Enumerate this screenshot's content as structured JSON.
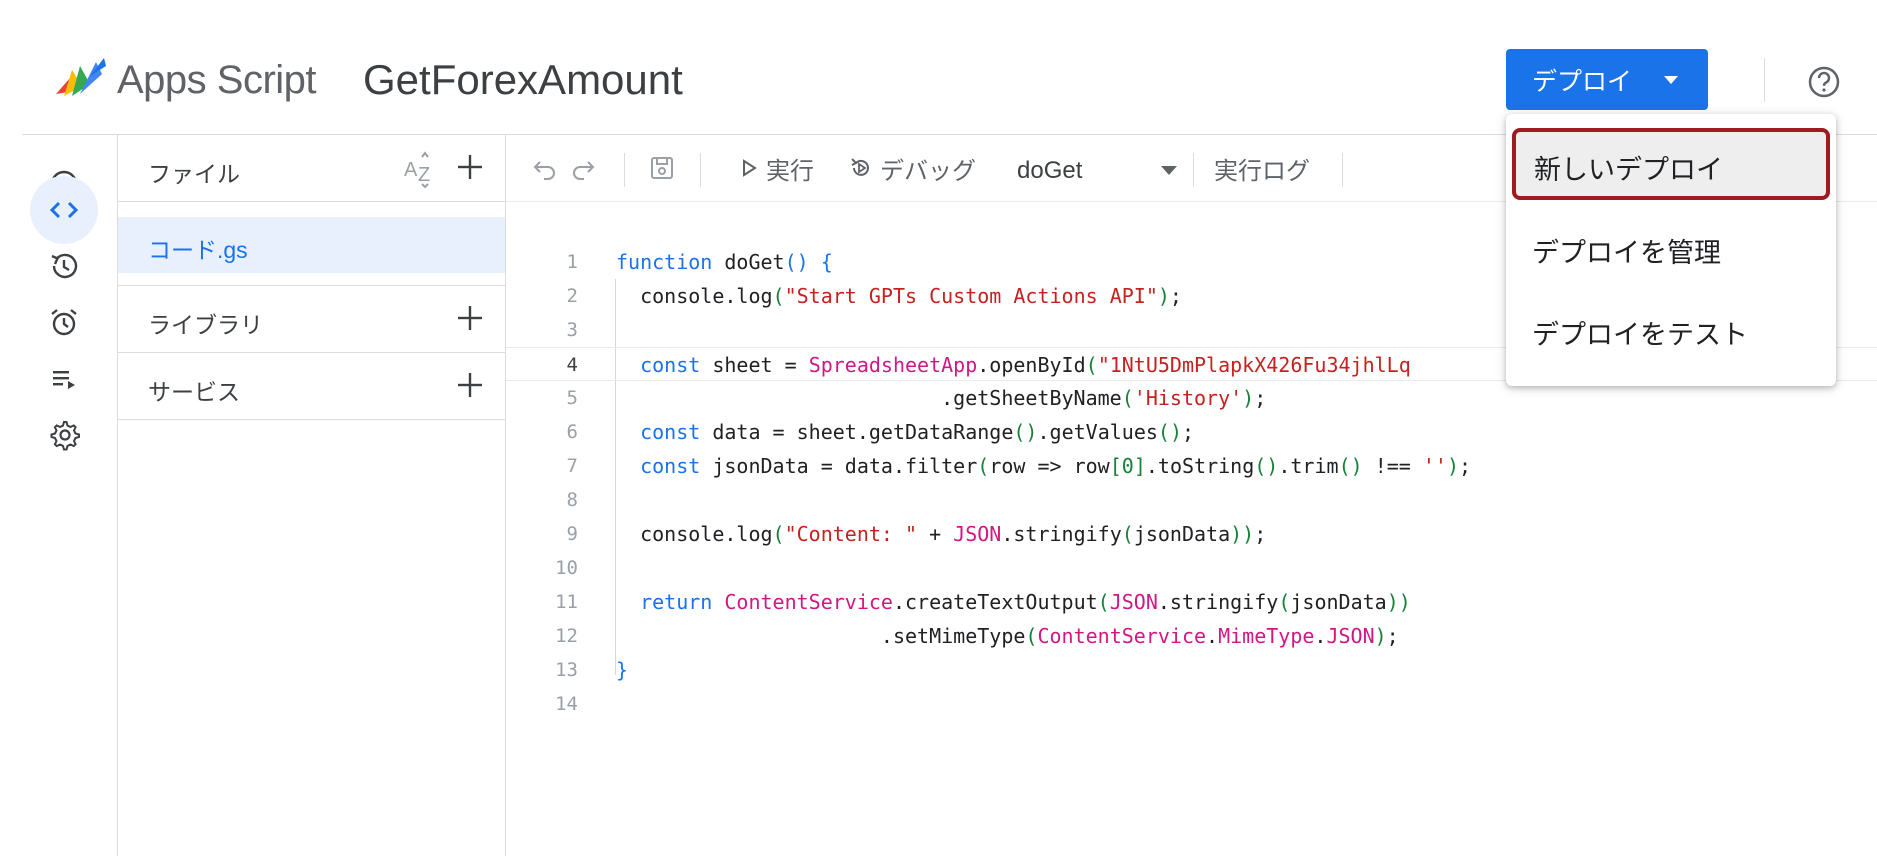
{
  "header": {
    "app_name": "Apps Script",
    "project_title": "GetForexAmount",
    "deploy_label": "デプロイ",
    "icons": [
      "apps-script-logo",
      "caret-down-icon",
      "help-icon"
    ]
  },
  "rail": {
    "items": [
      "info-icon",
      "code-icon",
      "history-icon",
      "alarm-icon",
      "executions-icon",
      "settings-icon"
    ],
    "active": "code-icon"
  },
  "files_panel": {
    "files_label": "ファイル",
    "selected_file": "コード.gs",
    "libraries_label": "ライブラリ",
    "services_label": "サービス"
  },
  "toolbar": {
    "run_label": "実行",
    "debug_label": "デバッグ",
    "function_selected": "doGet",
    "log_label": "実行ログ"
  },
  "editor": {
    "line_numbers": [
      "1",
      "2",
      "3",
      "4",
      "5",
      "6",
      "7",
      "8",
      "9",
      "10",
      "11",
      "12",
      "13",
      "14"
    ],
    "current_line": 4
  },
  "deploy_menu": {
    "items": [
      "新しいデプロイ",
      "デプロイを管理",
      "デプロイをテスト"
    ],
    "highlighted_index": 0
  },
  "colors": {
    "accent": "#1a73e8",
    "highlight_border": "#9e1b20",
    "string": "#c5221f",
    "class": "#d01884"
  }
}
